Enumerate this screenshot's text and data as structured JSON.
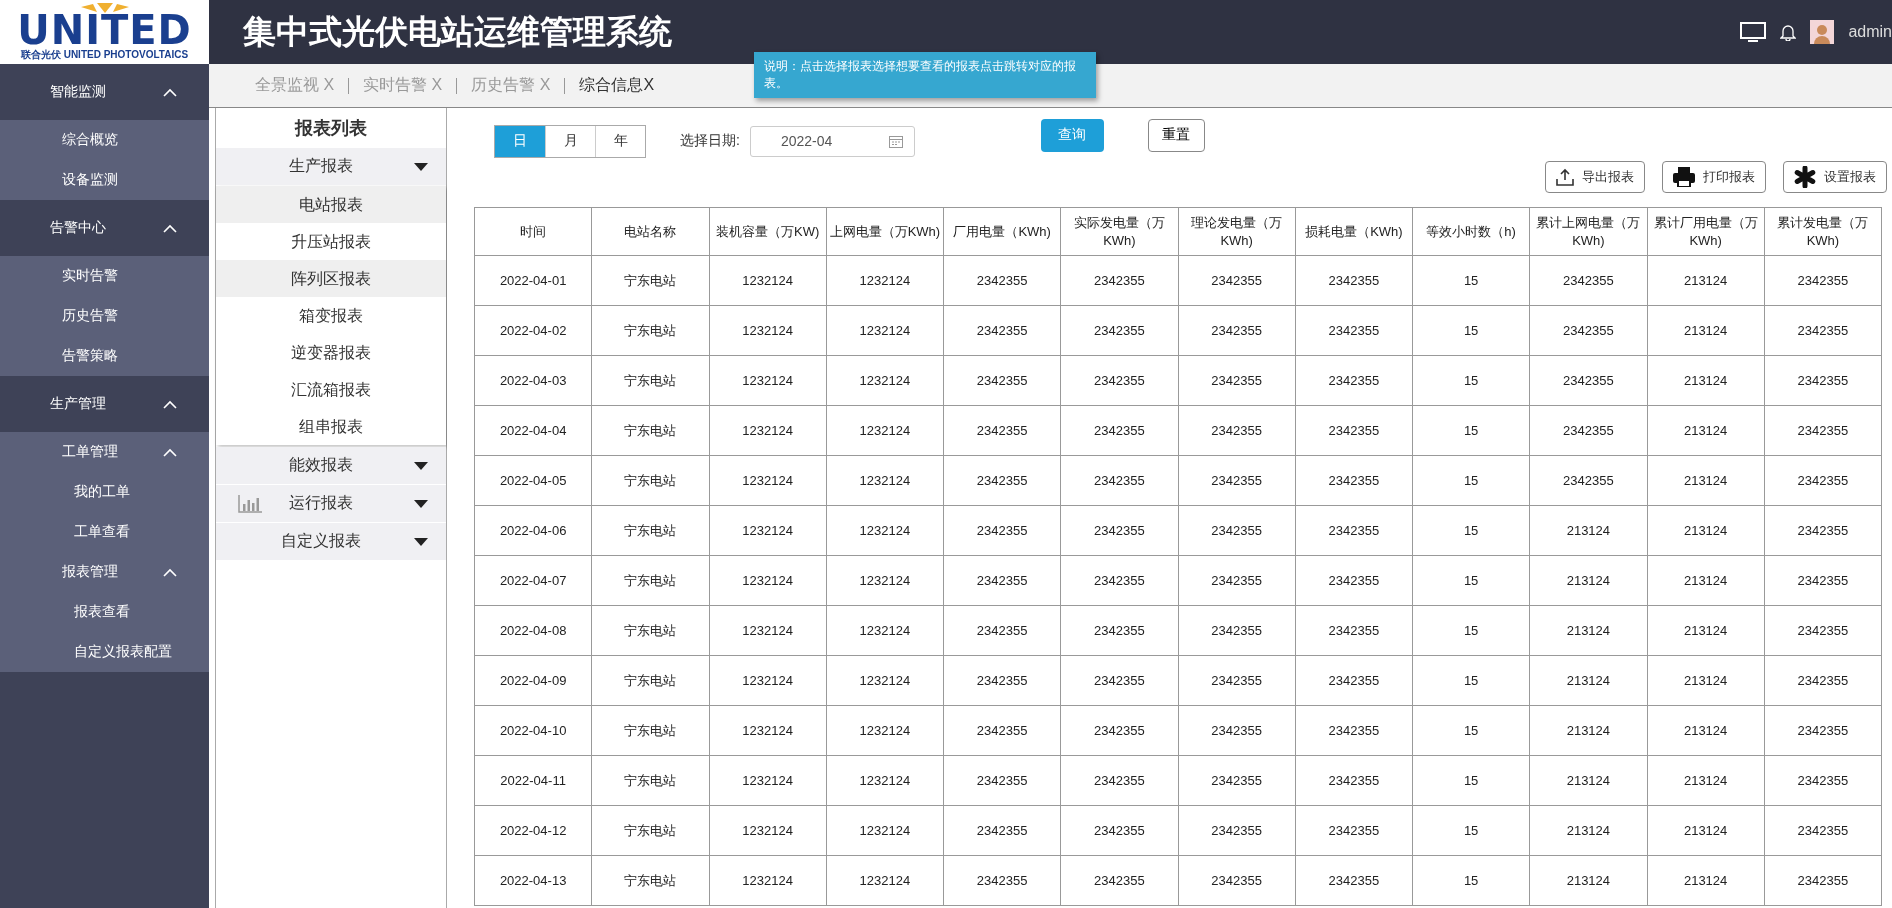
{
  "logo": {
    "name": "UNITED",
    "subtitle": "联合光伏 UNITED PHOTOVOLTAICS"
  },
  "header": {
    "title": "集中式光伏电站运维管理系统",
    "user": "admin"
  },
  "sidebar": {
    "groups": [
      {
        "label": "智能监测",
        "expanded": true,
        "children": [
          {
            "label": "综合概览"
          },
          {
            "label": "设备监测"
          }
        ]
      },
      {
        "label": "告警中心",
        "expanded": true,
        "children": [
          {
            "label": "实时告警"
          },
          {
            "label": "历史告警"
          },
          {
            "label": "告警策略"
          }
        ]
      },
      {
        "label": "生产管理",
        "expanded": true,
        "children": [
          {
            "label": "工单管理",
            "expanded": true,
            "children": [
              {
                "label": "我的工单"
              },
              {
                "label": "工单查看"
              }
            ]
          },
          {
            "label": "报表管理",
            "expanded": true,
            "children": [
              {
                "label": "报表查看"
              },
              {
                "label": "自定义报表配置"
              }
            ]
          }
        ]
      }
    ]
  },
  "tabs": [
    {
      "label": "全景监视 X",
      "selected": false
    },
    {
      "label": "实时告警 X",
      "selected": false
    },
    {
      "label": "历史告警 X",
      "selected": false
    },
    {
      "label": "综合信息X",
      "selected": true
    }
  ],
  "tooltip": "说明：点击选择报表选择想要查看的报表点击跳转对应的报表。",
  "report_list": {
    "title": "报表列表",
    "categories": [
      {
        "label": "生产报表",
        "kind": "plain",
        "children": [
          {
            "label": "电站报表",
            "selected": true
          },
          {
            "label": "升压站报表",
            "selected": false
          },
          {
            "label": "阵列区报表",
            "selected": true
          },
          {
            "label": "箱变报表",
            "selected": false
          },
          {
            "label": "逆变器报表",
            "selected": false
          },
          {
            "label": "汇流箱报表",
            "selected": false
          },
          {
            "label": "组串报表",
            "selected": false
          }
        ]
      },
      {
        "label": "能效报表",
        "kind": "plain"
      },
      {
        "label": "运行报表",
        "kind": "chart"
      },
      {
        "label": "自定义报表",
        "kind": "plain"
      }
    ]
  },
  "query": {
    "periods": [
      {
        "label": "日",
        "selected": true
      },
      {
        "label": "月",
        "selected": false
      },
      {
        "label": "年",
        "selected": false
      }
    ],
    "date_label": "选择日期:",
    "date_value": "2022-04",
    "search_button": "查询",
    "reset_button": "重置"
  },
  "actions": [
    {
      "label": "导出报表",
      "kind": "export"
    },
    {
      "label": "打印报表",
      "kind": "print"
    },
    {
      "label": "设置报表",
      "kind": "settings"
    }
  ],
  "table": {
    "columns": [
      "时间",
      "电站名称",
      "装机容量（万KW)",
      "上网电量（万KWh)",
      "厂用电量（KWh)",
      "实际发电量（万KWh)",
      "理论发电量（万KWh)",
      "损耗电量（KWh)",
      "等效小时数（h)",
      "累计上网电量（万KWh)",
      "累计厂用电量（万KWh)",
      "累计发电量（万KWh)"
    ],
    "rows": [
      [
        "2022-04-01",
        "宁东电站",
        "1232124",
        "1232124",
        "2342355",
        "2342355",
        "2342355",
        "2342355",
        "15",
        "2342355",
        "213124",
        "2342355"
      ],
      [
        "2022-04-02",
        "宁东电站",
        "1232124",
        "1232124",
        "2342355",
        "2342355",
        "2342355",
        "2342355",
        "15",
        "2342355",
        "213124",
        "2342355"
      ],
      [
        "2022-04-03",
        "宁东电站",
        "1232124",
        "1232124",
        "2342355",
        "2342355",
        "2342355",
        "2342355",
        "15",
        "2342355",
        "213124",
        "2342355"
      ],
      [
        "2022-04-04",
        "宁东电站",
        "1232124",
        "1232124",
        "2342355",
        "2342355",
        "2342355",
        "2342355",
        "15",
        "2342355",
        "213124",
        "2342355"
      ],
      [
        "2022-04-05",
        "宁东电站",
        "1232124",
        "1232124",
        "2342355",
        "2342355",
        "2342355",
        "2342355",
        "15",
        "2342355",
        "213124",
        "2342355"
      ],
      [
        "2022-04-06",
        "宁东电站",
        "1232124",
        "1232124",
        "2342355",
        "2342355",
        "2342355",
        "2342355",
        "15",
        "213124",
        "213124",
        "2342355"
      ],
      [
        "2022-04-07",
        "宁东电站",
        "1232124",
        "1232124",
        "2342355",
        "2342355",
        "2342355",
        "2342355",
        "15",
        "213124",
        "213124",
        "2342355"
      ],
      [
        "2022-04-08",
        "宁东电站",
        "1232124",
        "1232124",
        "2342355",
        "2342355",
        "2342355",
        "2342355",
        "15",
        "213124",
        "213124",
        "2342355"
      ],
      [
        "2022-04-09",
        "宁东电站",
        "1232124",
        "1232124",
        "2342355",
        "2342355",
        "2342355",
        "2342355",
        "15",
        "213124",
        "213124",
        "2342355"
      ],
      [
        "2022-04-10",
        "宁东电站",
        "1232124",
        "1232124",
        "2342355",
        "2342355",
        "2342355",
        "2342355",
        "15",
        "213124",
        "213124",
        "2342355"
      ],
      [
        "2022-04-11",
        "宁东电站",
        "1232124",
        "1232124",
        "2342355",
        "2342355",
        "2342355",
        "2342355",
        "15",
        "213124",
        "213124",
        "2342355"
      ],
      [
        "2022-04-12",
        "宁东电站",
        "1232124",
        "1232124",
        "2342355",
        "2342355",
        "2342355",
        "2342355",
        "15",
        "213124",
        "213124",
        "2342355"
      ],
      [
        "2022-04-13",
        "宁东电站",
        "1232124",
        "1232124",
        "2342355",
        "2342355",
        "2342355",
        "2342355",
        "15",
        "213124",
        "213124",
        "2342355"
      ]
    ]
  }
}
